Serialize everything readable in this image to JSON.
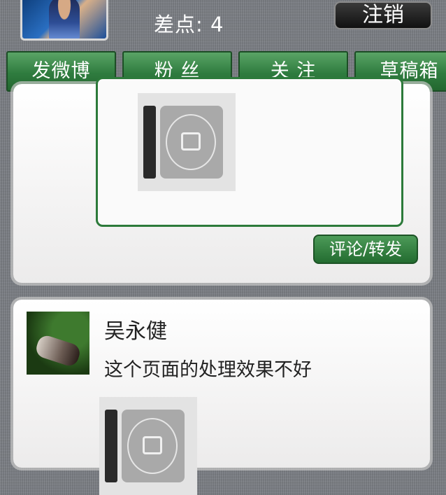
{
  "header": {
    "score_label": "差点:",
    "score_value": "4",
    "logout_label": "注销"
  },
  "tabs": [
    {
      "label": "发微博"
    },
    {
      "label": "粉 丝"
    },
    {
      "label": "关 注"
    },
    {
      "label": "草稿箱"
    }
  ],
  "feed": {
    "post1": {
      "comment_button_label": "评论/转发"
    },
    "post2": {
      "username": "吴永健",
      "text": "这个页面的处理效果不好"
    }
  },
  "colors": {
    "tab_green": "#2f7c3f",
    "repost_border": "#2c7a3a",
    "logout_bg": "#111111"
  },
  "icons": {
    "user_avatar": "avatar",
    "thumbnail": "image-thumbnail"
  }
}
